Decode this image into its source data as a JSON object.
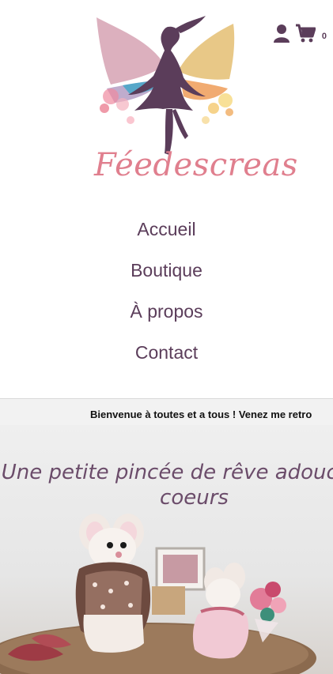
{
  "brand": {
    "name": "Féedescreas"
  },
  "header": {
    "cart_count": "0"
  },
  "nav": {
    "items": [
      {
        "label": "Accueil"
      },
      {
        "label": "Boutique"
      },
      {
        "label": "À propos"
      },
      {
        "label": "Contact"
      }
    ]
  },
  "ticker": {
    "text": "Bienvenue à toutes et a tous ! Venez me retro"
  },
  "hero": {
    "title": "Une petite pincée de rêve adoucit les coeurs"
  },
  "colors": {
    "accent": "#5b3d5a",
    "brand_pink": "#e07f8e",
    "hero_text": "#6b4c6a"
  }
}
